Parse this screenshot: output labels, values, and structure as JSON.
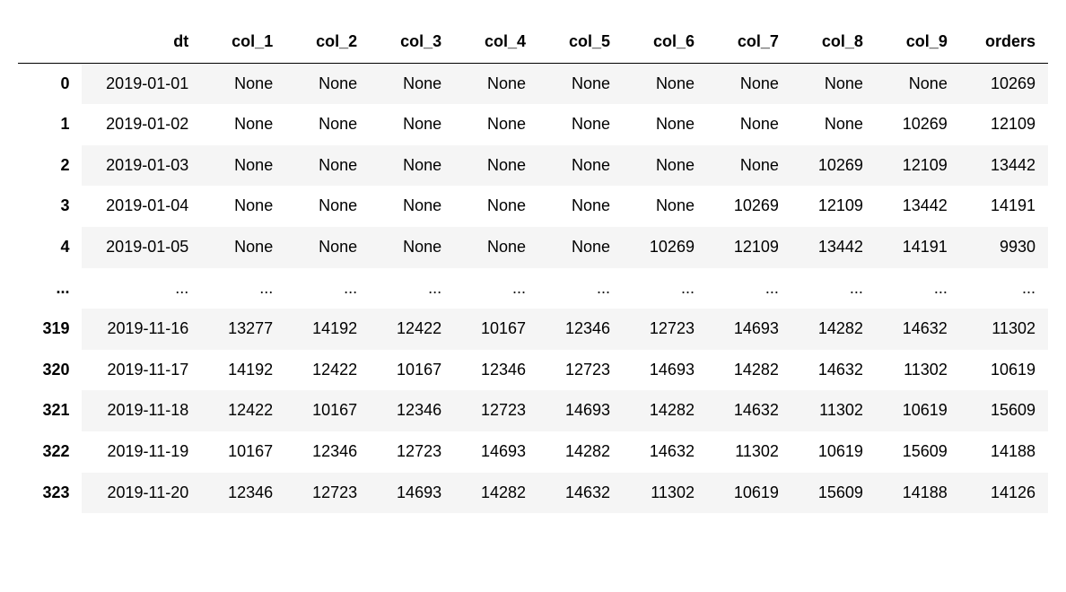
{
  "table": {
    "index_header": "",
    "columns": [
      "dt",
      "col_1",
      "col_2",
      "col_3",
      "col_4",
      "col_5",
      "col_6",
      "col_7",
      "col_8",
      "col_9",
      "orders"
    ],
    "rows": [
      {
        "index": "0",
        "cells": [
          "2019-01-01",
          "None",
          "None",
          "None",
          "None",
          "None",
          "None",
          "None",
          "None",
          "None",
          "10269"
        ]
      },
      {
        "index": "1",
        "cells": [
          "2019-01-02",
          "None",
          "None",
          "None",
          "None",
          "None",
          "None",
          "None",
          "None",
          "10269",
          "12109"
        ]
      },
      {
        "index": "2",
        "cells": [
          "2019-01-03",
          "None",
          "None",
          "None",
          "None",
          "None",
          "None",
          "None",
          "10269",
          "12109",
          "13442"
        ]
      },
      {
        "index": "3",
        "cells": [
          "2019-01-04",
          "None",
          "None",
          "None",
          "None",
          "None",
          "None",
          "10269",
          "12109",
          "13442",
          "14191"
        ]
      },
      {
        "index": "4",
        "cells": [
          "2019-01-05",
          "None",
          "None",
          "None",
          "None",
          "None",
          "10269",
          "12109",
          "13442",
          "14191",
          "9930"
        ]
      },
      {
        "index": "...",
        "cells": [
          "...",
          "...",
          "...",
          "...",
          "...",
          "...",
          "...",
          "...",
          "...",
          "...",
          "..."
        ]
      },
      {
        "index": "319",
        "cells": [
          "2019-11-16",
          "13277",
          "14192",
          "12422",
          "10167",
          "12346",
          "12723",
          "14693",
          "14282",
          "14632",
          "11302"
        ]
      },
      {
        "index": "320",
        "cells": [
          "2019-11-17",
          "14192",
          "12422",
          "10167",
          "12346",
          "12723",
          "14693",
          "14282",
          "14632",
          "11302",
          "10619"
        ]
      },
      {
        "index": "321",
        "cells": [
          "2019-11-18",
          "12422",
          "10167",
          "12346",
          "12723",
          "14693",
          "14282",
          "14632",
          "11302",
          "10619",
          "15609"
        ]
      },
      {
        "index": "322",
        "cells": [
          "2019-11-19",
          "10167",
          "12346",
          "12723",
          "14693",
          "14282",
          "14632",
          "11302",
          "10619",
          "15609",
          "14188"
        ]
      },
      {
        "index": "323",
        "cells": [
          "2019-11-20",
          "12346",
          "12723",
          "14693",
          "14282",
          "14632",
          "11302",
          "10619",
          "15609",
          "14188",
          "14126"
        ]
      }
    ]
  }
}
